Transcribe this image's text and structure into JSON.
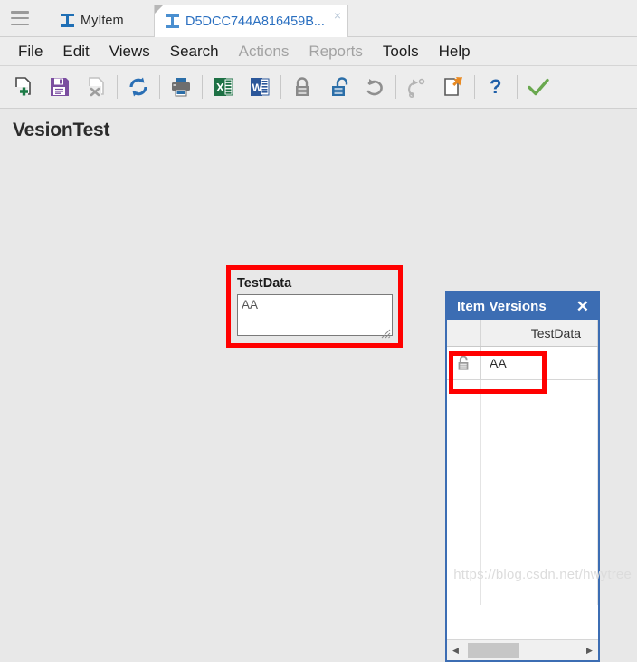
{
  "tabbar": {
    "menu_icon": "hamburger-icon",
    "tabs": [
      {
        "label": "MyItem",
        "icon": "ibeam-icon",
        "active": false
      },
      {
        "label": "D5DCC744A816459B...",
        "icon": "ibeam-icon",
        "active": true,
        "close_label": "×"
      }
    ]
  },
  "menubar": {
    "items": [
      {
        "label": "File",
        "disabled": false
      },
      {
        "label": "Edit",
        "disabled": false
      },
      {
        "label": "Views",
        "disabled": false
      },
      {
        "label": "Search",
        "disabled": false
      },
      {
        "label": "Actions",
        "disabled": true
      },
      {
        "label": "Reports",
        "disabled": true
      },
      {
        "label": "Tools",
        "disabled": false
      },
      {
        "label": "Help",
        "disabled": false
      }
    ]
  },
  "toolbar": {
    "buttons": [
      {
        "name": "new-item-icon",
        "title": "New"
      },
      {
        "name": "save-icon",
        "title": "Save"
      },
      {
        "name": "delete-icon",
        "title": "Delete"
      },
      {
        "name": "refresh-icon",
        "title": "Refresh"
      },
      {
        "name": "print-icon",
        "title": "Print"
      },
      {
        "name": "export-excel-icon",
        "title": "Export to Excel"
      },
      {
        "name": "export-word-icon",
        "title": "Export to Word"
      },
      {
        "name": "lock-icon",
        "title": "Lock"
      },
      {
        "name": "unlock-icon",
        "title": "Unlock"
      },
      {
        "name": "undo-icon",
        "title": "Undo"
      },
      {
        "name": "redo-icon",
        "title": "Redo"
      },
      {
        "name": "copy-item-icon",
        "title": "Copy Item"
      },
      {
        "name": "help-icon",
        "title": "Help"
      },
      {
        "name": "check-icon",
        "title": "Apply"
      }
    ]
  },
  "workspace": {
    "page_title": "VesionTest",
    "field": {
      "label": "TestData",
      "value": "AA",
      "placeholder": ""
    }
  },
  "versions_panel": {
    "title": "Item Versions",
    "close_label": "✕",
    "columns": [
      {
        "key": "lock",
        "label": ""
      },
      {
        "key": "testdata",
        "label": "TestData"
      }
    ],
    "rows": [
      {
        "lock_icon": "unlocked-padlock-icon",
        "testdata": "AA"
      }
    ],
    "scrollbar": {
      "left_arrow": "◀",
      "right_arrow": "▶"
    }
  },
  "annotations": {
    "highlight_color": "#ff0000",
    "boxes": [
      {
        "name": "testdata-field-highlight"
      },
      {
        "name": "versions-row-highlight"
      }
    ]
  },
  "watermark": {
    "text": "https://blog.csdn.net/hwytree"
  },
  "colors": {
    "accent_blue": "#3c6db3",
    "tab_blue": "#2a6fc0",
    "chrome_gray": "#ededed",
    "workspace_gray": "#e8e8e8"
  }
}
